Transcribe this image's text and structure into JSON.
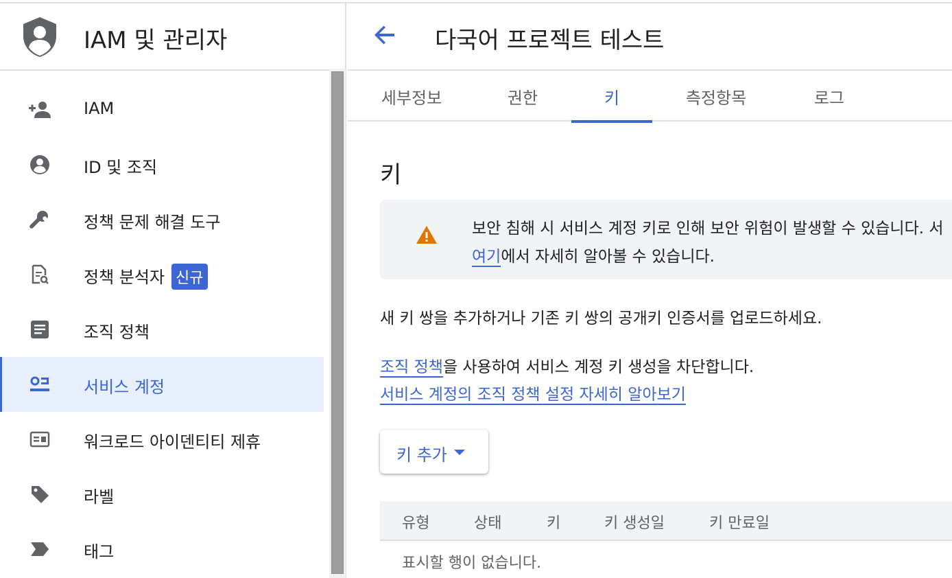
{
  "sidebar": {
    "title": "IAM 및 관리자",
    "items": [
      {
        "label": "IAM",
        "icon": "person-add-icon"
      },
      {
        "label": "ID 및 조직",
        "icon": "account-circle-icon"
      },
      {
        "label": "정책 문제 해결 도구",
        "icon": "wrench-icon"
      },
      {
        "label": "정책 분석자",
        "icon": "document-search-icon",
        "badge": "신규"
      },
      {
        "label": "조직 정책",
        "icon": "article-icon"
      },
      {
        "label": "서비스 계정",
        "icon": "service-account-icon",
        "active": true
      },
      {
        "label": "워크로드 아이덴티티 제휴",
        "icon": "id-card-icon"
      },
      {
        "label": "라벨",
        "icon": "label-tag-icon"
      },
      {
        "label": "태그",
        "icon": "tag-chevron-icon"
      }
    ]
  },
  "header": {
    "title": "다국어 프로젝트 테스트"
  },
  "tabs": [
    {
      "label": "세부정보"
    },
    {
      "label": "권한"
    },
    {
      "label": "키",
      "active": true
    },
    {
      "label": "측정항목"
    },
    {
      "label": "로그"
    }
  ],
  "keys": {
    "section_title": "키",
    "alert": {
      "line1": "보안 침해 시 서비스 계정 키로 인해 보안 위험이 발생할 수 있습니다. 서",
      "line2_link": "여기",
      "line2_rest": "에서 자세히 알아볼 수 있습니다."
    },
    "description": "새 키 쌍을 추가하거나 기존 키 쌍의 공개키 인증서를 업로드하세요.",
    "policy_link": "조직 정책",
    "policy_rest": "을 사용하여 서비스 계정 키 생성을 차단합니다.",
    "policy_learn_more": "서비스 계정의 조직 정책 설정 자세히 알아보기",
    "add_key_label": "키 추가",
    "table": {
      "columns": [
        "유형",
        "상태",
        "키",
        "키 생성일",
        "키 만료일"
      ],
      "empty_message": "표시할 행이 없습니다."
    }
  },
  "colors": {
    "accent": "#3c66d1",
    "warning": "#e37400",
    "active_bg": "#e8f0fe"
  }
}
